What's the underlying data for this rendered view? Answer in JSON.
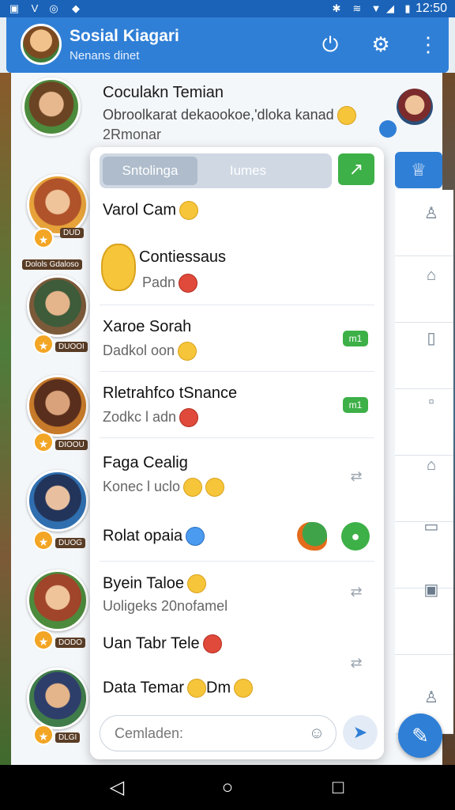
{
  "status_bar": {
    "time": "12:50"
  },
  "app_bar": {
    "title": "Sosial Kiagari",
    "subtitle": "Nenans dinet",
    "icons": [
      "power-icon",
      "gear-icon",
      "more-vert-icon"
    ]
  },
  "main": {
    "top_item": {
      "name": "Coculakn Temian",
      "message": "Obroolkarat dekaookoe,'dloka kanad",
      "message_line2": "2Rmonar"
    },
    "left_labels": [
      "DUD",
      "Dolols Gdaloso",
      "DUOOI",
      "DIOOU",
      "DUOG",
      "DODO",
      "DLGI"
    ]
  },
  "card": {
    "tabs": [
      "Sntolinga",
      "Iumes"
    ],
    "first_line": "Varol Cam",
    "rows": [
      {
        "name": "Contiessaus",
        "sub": "Padn"
      },
      {
        "name": "Xaroe Sorah",
        "sub": "Dadkol oon",
        "badge": "m1"
      },
      {
        "name": "Rletrahfco tSnance",
        "sub": "Zodkc l adn",
        "badge": "m1"
      },
      {
        "name": "Faga Cealig",
        "sub": "Konec l uclo"
      },
      {
        "name": "Rolat opaia"
      },
      {
        "name": "Byein Taloe",
        "sub": "Uoligeks 20nofamel"
      },
      {
        "name": "Uan Tabr Tele"
      },
      {
        "name": "Data Temar",
        "suffix": "Dm"
      }
    ],
    "composer_placeholder": "Cemladen:"
  }
}
